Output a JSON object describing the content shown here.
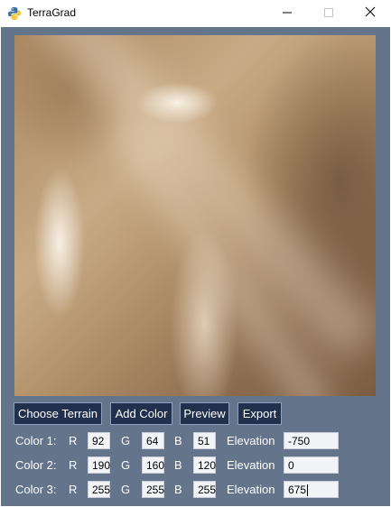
{
  "window": {
    "title": "TerraGrad",
    "icons": {
      "app": "python-icon",
      "minimize": "minimize-icon",
      "maximize": "maximize-icon",
      "close": "close-icon"
    }
  },
  "colors": {
    "client_bg": "#64748b",
    "button_bg": "#20304d",
    "text_light": "#ffffff"
  },
  "toolbar": {
    "choose_terrain": "Choose Terrain",
    "add_color": "Add Color",
    "preview": "Preview",
    "export": "Export"
  },
  "labels": {
    "r": "R",
    "g": "G",
    "b": "B",
    "elevation": "Elevation"
  },
  "color_rows": [
    {
      "label": "Color 1:",
      "r": "92",
      "g": "64",
      "b": "51",
      "elevation": "-750"
    },
    {
      "label": "Color 2:",
      "r": "190",
      "g": "160",
      "b": "120",
      "elevation": "0"
    },
    {
      "label": "Color 3:",
      "r": "255",
      "g": "255",
      "b": "255",
      "elevation": "675"
    }
  ]
}
